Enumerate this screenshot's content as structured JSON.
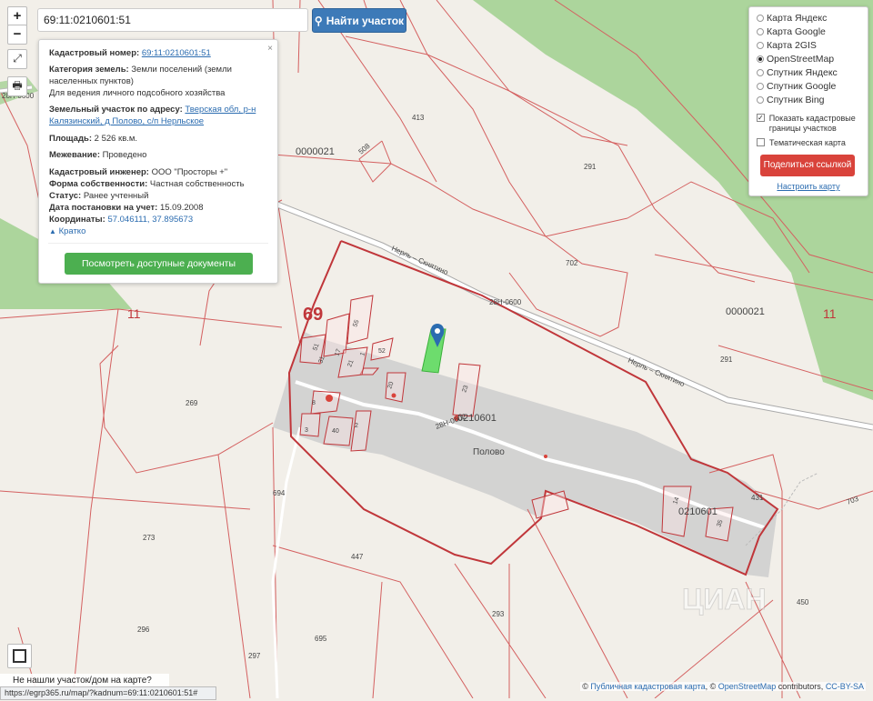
{
  "search": {
    "value": "69:11:0210601:51",
    "button_label": "Найти участок"
  },
  "info": {
    "cadastral_label": "Кадастровый номер:",
    "cadastral_value": "69:11:0210601:51",
    "category_label": "Категория земель:",
    "category_value": "Земли поселений (земли населенных пунктов)",
    "usage": "Для ведения личного подсобного хозяйства",
    "address_label": "Земельный участок по адресу:",
    "address_value": "Тверская обл, р-н Калязинский, д Полово, с/п Нерльское",
    "area_label": "Площадь:",
    "area_value": "2 526 кв.м.",
    "survey_label": "Межевание:",
    "survey_value": "Проведено",
    "engineer_label": "Кадастровый инженер:",
    "engineer_value": "ООО \"Просторы +\"",
    "ownership_label": "Форма собственности:",
    "ownership_value": "Частная собственность",
    "status_label": "Статус:",
    "status_value": "Ранее учтенный",
    "date_label": "Дата постановки на учет:",
    "date_value": "15.09.2008",
    "coords_label": "Координаты:",
    "coords_value": "57.046111, 37.895673",
    "brief_link": "Кратко",
    "docs_button": "Посмотреть доступные документы",
    "close": "×"
  },
  "layers": {
    "options": [
      "Карта Яндекс",
      "Карта Google",
      "Карта 2GIS",
      "OpenStreetMap",
      "Спутник Яндекс",
      "Спутник Google",
      "Спутник Bing"
    ],
    "selected": "OpenStreetMap",
    "show_borders": "Показать кадастровые границы участков",
    "thematic": "Тематическая карта",
    "share_button": "Поделиться ссылкой",
    "setup_link": "Настроить карту"
  },
  "map_labels": {
    "region": "69",
    "district_left": "11",
    "district_right": "11",
    "road_name_1": "Нерль – Скнятино",
    "road_name_2": "Нерль – Скнятино",
    "road_code_1": "28Н-0600",
    "road_code_2": "28Н-0602",
    "road_code_3": "28Н-0600",
    "quarter_1": "0000021",
    "quarter_2": "0000021",
    "quarter_3": "0210601",
    "quarter_4": "0210601",
    "village": "Полово",
    "parcels": [
      "413",
      "508",
      "291",
      "702",
      "291",
      "269",
      "694",
      "273",
      "296",
      "297",
      "695",
      "447",
      "293",
      "431",
      "703",
      "450",
      "51",
      "55",
      "52",
      "17",
      "31",
      "21",
      "1",
      "2",
      "8",
      "3",
      "40",
      "20",
      "23",
      "14",
      "35"
    ]
  },
  "watermark": "ЦИАН",
  "bottom_hint": "Не нашли участок/дом на карте?",
  "status_url": "https://egrp365.ru/map/?kadnum=69:11:0210601:51#",
  "attribution": {
    "prefix": "© ",
    "pkk": "Публичная кадастровая карта",
    "sep": ", © ",
    "osm": "OpenStreetMap",
    "contributors": " contributors, ",
    "license": "CC-BY-SA"
  }
}
